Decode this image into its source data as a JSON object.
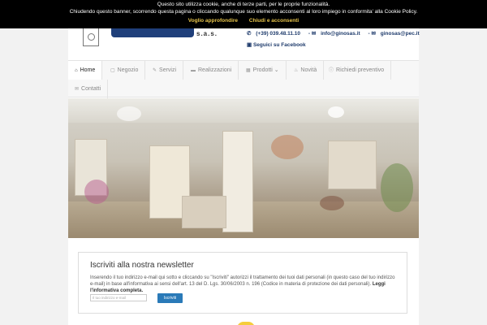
{
  "cookie_banner": {
    "line1": "Questo sito utilizza cookie, anche di terze parti, per le proprie funzionalità.",
    "line2": "Chiudendo questo banner, scorrendo questa pagina o cliccando qualunque suo elemento acconsenti al loro impiego in conformita' alla Cookie Policy.",
    "more_label": "Voglio approfondire",
    "close_label": "Chiudi e acconsenti"
  },
  "header": {
    "logo_suffix": "s.a.s.",
    "phone": "(+39) 039.48.11.10",
    "email": "info@ginosas.it",
    "pec": "ginosas@pec.it",
    "facebook_label": "Seguici su Facebook"
  },
  "nav": {
    "items": [
      {
        "label": "Home",
        "icon": "home-icon"
      },
      {
        "label": "Negozio",
        "icon": "lock-icon"
      },
      {
        "label": "Servizi",
        "icon": "wrench-icon"
      },
      {
        "label": "Realizzazioni",
        "icon": "card-icon"
      },
      {
        "label": "Prodotti",
        "icon": "grid-icon"
      },
      {
        "label": "Novità",
        "icon": "flame-icon"
      },
      {
        "label": "Richiedi preventivo",
        "icon": "info-icon"
      },
      {
        "label": "Contatti",
        "icon": "envelope-icon"
      }
    ]
  },
  "newsletter": {
    "title": "Iscriviti alla nostra newsletter",
    "text": "Inserendo il tuo indirizzo e-mail qui sotto e cliccando su \"Iscriviti\" autorizzi il trattamento dei tuoi dati personali (in questo caso del tuo indirizzo e-mail) in base all'informativa ai sensi dell'art. 13 del D. Lgs. 30/06/2003 n. 196 (Codice in materia di protezione dei dati personali).",
    "link_label": "Leggi l'informativa completa.",
    "email_placeholder": "Il tuo indirizzo e-mail",
    "subscribe_label": "Iscriviti"
  }
}
